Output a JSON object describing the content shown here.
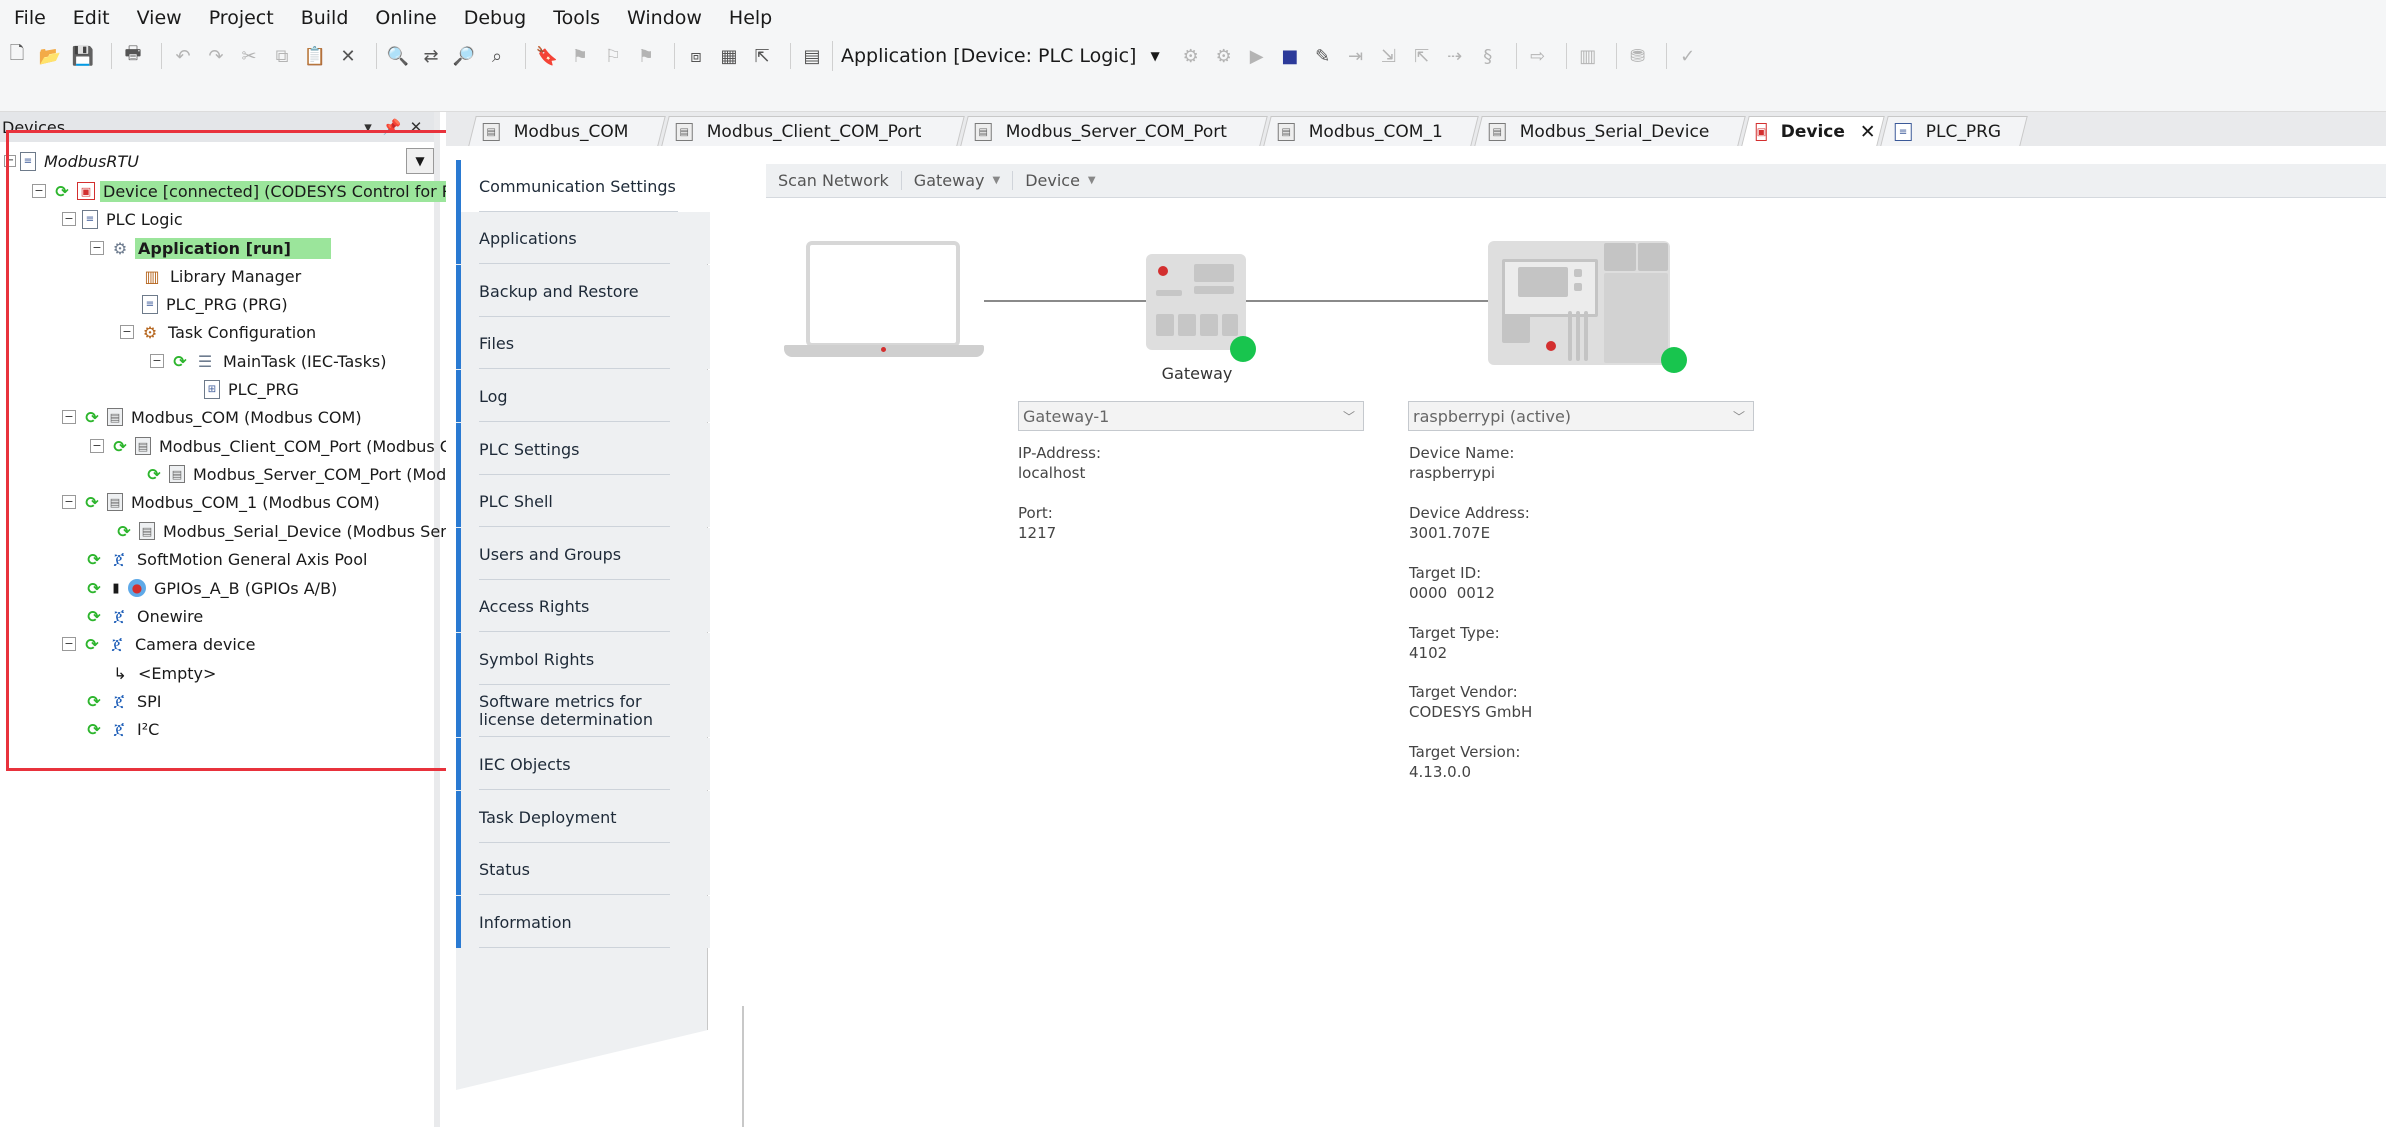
{
  "menu": [
    "File",
    "Edit",
    "View",
    "Project",
    "Build",
    "Online",
    "Debug",
    "Tools",
    "Window",
    "Help"
  ],
  "toolbar": {
    "application_combo": "Application [Device: PLC Logic]"
  },
  "devices_panel": {
    "title": "Devices",
    "project": "ModbusRTU",
    "tree": [
      {
        "label": "Device [connected] (CODESYS Control for Ras",
        "highlight": true
      },
      {
        "label": "PLC Logic"
      },
      {
        "label": "Application [run]",
        "highlight": true,
        "bold": true
      },
      {
        "label": "Library Manager"
      },
      {
        "label": "PLC_PRG (PRG)"
      },
      {
        "label": "Task Configuration"
      },
      {
        "label": "MainTask (IEC-Tasks)"
      },
      {
        "label": "PLC_PRG"
      },
      {
        "label": "Modbus_COM (Modbus COM)"
      },
      {
        "label": "Modbus_Client_COM_Port (Modbus Cl"
      },
      {
        "label": "Modbus_Server_COM_Port (Modb"
      },
      {
        "label": "Modbus_COM_1 (Modbus COM)"
      },
      {
        "label": "Modbus_Serial_Device (Modbus Serial"
      },
      {
        "label": "SoftMotion General Axis Pool"
      },
      {
        "label": "GPIOs_A_B (GPIOs A/B)"
      },
      {
        "label": "Onewire"
      },
      {
        "label": "Camera device"
      },
      {
        "label": "<Empty>"
      },
      {
        "label": "SPI"
      },
      {
        "label": "I²C"
      }
    ]
  },
  "editor_tabs": [
    {
      "label": "Modbus_COM"
    },
    {
      "label": "Modbus_Client_COM_Port"
    },
    {
      "label": "Modbus_Server_COM_Port"
    },
    {
      "label": "Modbus_COM_1"
    },
    {
      "label": "Modbus_Serial_Device"
    },
    {
      "label": "Device",
      "active": true
    },
    {
      "label": "PLC_PRG"
    }
  ],
  "settings_nav": [
    "Communication Settings",
    "Applications",
    "Backup and Restore",
    "Files",
    "Log",
    "PLC Settings",
    "PLC Shell",
    "Users and Groups",
    "Access Rights",
    "Symbol Rights",
    "Software metrics for license determination",
    "IEC Objects",
    "Task Deployment",
    "Status",
    "Information"
  ],
  "content_toolbar": {
    "scan_network": "Scan Network",
    "gateway": "Gateway",
    "device": "Device"
  },
  "gateway": {
    "caption": "Gateway",
    "combo": "Gateway-1",
    "ip_label": "IP-Address:",
    "ip_value": "localhost",
    "port_label": "Port:",
    "port_value": "1217"
  },
  "device": {
    "combo": "raspberrypi (active)",
    "name_label": "Device Name:",
    "name_value": "raspberrypi",
    "address_label": "Device Address:",
    "address_value": "3001.707E",
    "target_id_label": "Target ID:",
    "target_id_value": "0000  0012",
    "target_type_label": "Target Type:",
    "target_type_value": "4102",
    "vendor_label": "Target Vendor:",
    "vendor_value": "CODESYS GmbH",
    "version_label": "Target Version:",
    "version_value": "4.13.0.0"
  },
  "colors": {
    "highlight_green": "#9be59b",
    "status_green": "#18c54e",
    "annotation_red": "#e8323c",
    "nav_accent": "#2a7ad2"
  }
}
